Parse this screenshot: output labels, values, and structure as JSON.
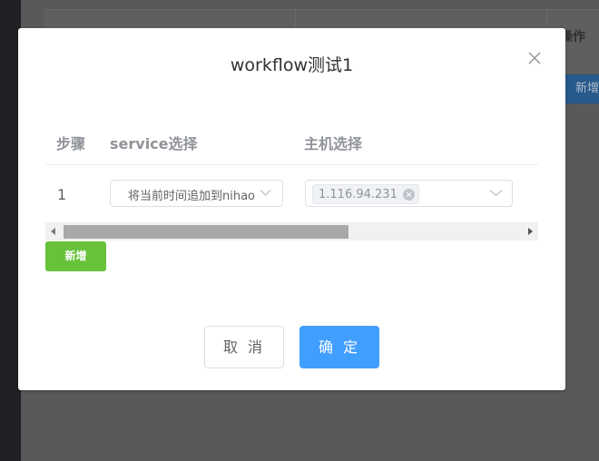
{
  "background": {
    "column_header": "操作",
    "add_button": "新增"
  },
  "dialog": {
    "title": "workflow测试1",
    "table": {
      "headers": [
        "步骤",
        "service选择",
        "主机选择"
      ],
      "rows": [
        {
          "step": "1",
          "service_value": "将当前时间追加到nihao",
          "host_tags": [
            "1.116.94.231"
          ]
        }
      ]
    },
    "add_label": "新增",
    "cancel_label": "取 消",
    "confirm_label": "确 定"
  },
  "colors": {
    "primary": "#409eff",
    "success": "#67c23a",
    "overlay": "#595959"
  },
  "icons": {
    "close": "close-icon",
    "select_arrow": "chevron-down-icon",
    "tag_remove": "circle-close-icon"
  }
}
